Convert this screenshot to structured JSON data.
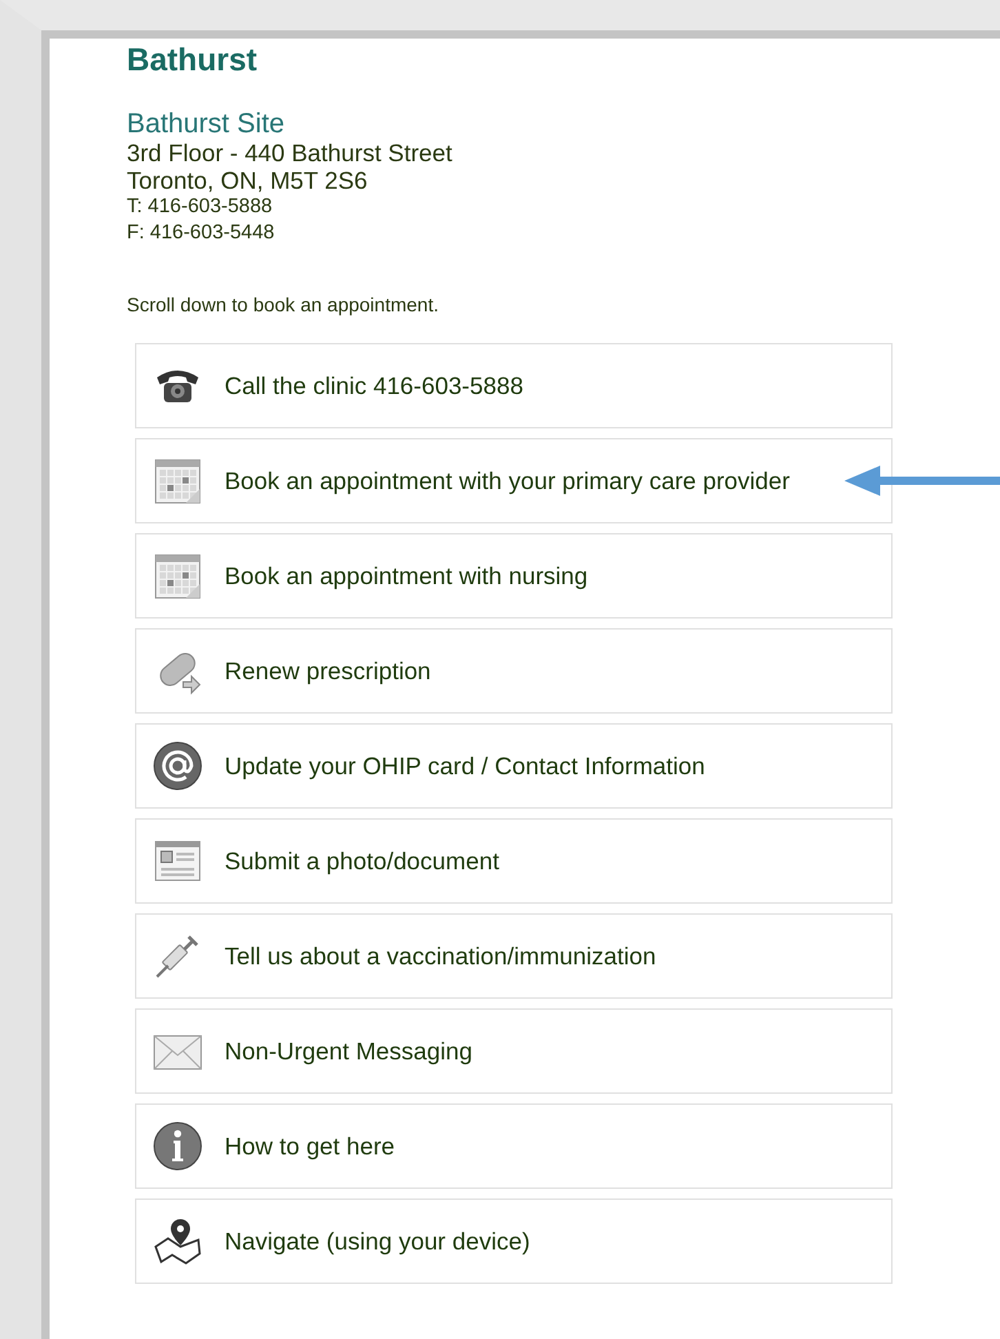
{
  "heading": "Bathurst",
  "site": {
    "name": "Bathurst Site",
    "address_lines": [
      "3rd Floor - 440 Bathurst Street",
      "Toronto, ON, M5T 2S6"
    ],
    "phone": "T: 416-603-5888",
    "fax": "F: 416-603-5448"
  },
  "intro": "Scroll down to book an appointment.",
  "actions": [
    {
      "kind": "phone",
      "label": "Call the clinic 416-603-5888",
      "pointed": false
    },
    {
      "kind": "calendar",
      "label": "Book an appointment with your primary care provider",
      "pointed": true
    },
    {
      "kind": "calendar",
      "label": "Book an appointment with nursing",
      "pointed": false
    },
    {
      "kind": "pill",
      "label": "Renew prescription",
      "pointed": false
    },
    {
      "kind": "at",
      "label": "Update your OHIP card / Contact Information",
      "pointed": false
    },
    {
      "kind": "document",
      "label": "Submit a photo/document",
      "pointed": false
    },
    {
      "kind": "syringe",
      "label": "Tell us about a vaccination/immunization",
      "pointed": false
    },
    {
      "kind": "mail",
      "label": "Non-Urgent Messaging",
      "pointed": false
    },
    {
      "kind": "info",
      "label": "How to get here",
      "pointed": false
    },
    {
      "kind": "map",
      "label": "Navigate (using your device)",
      "pointed": false
    }
  ]
}
